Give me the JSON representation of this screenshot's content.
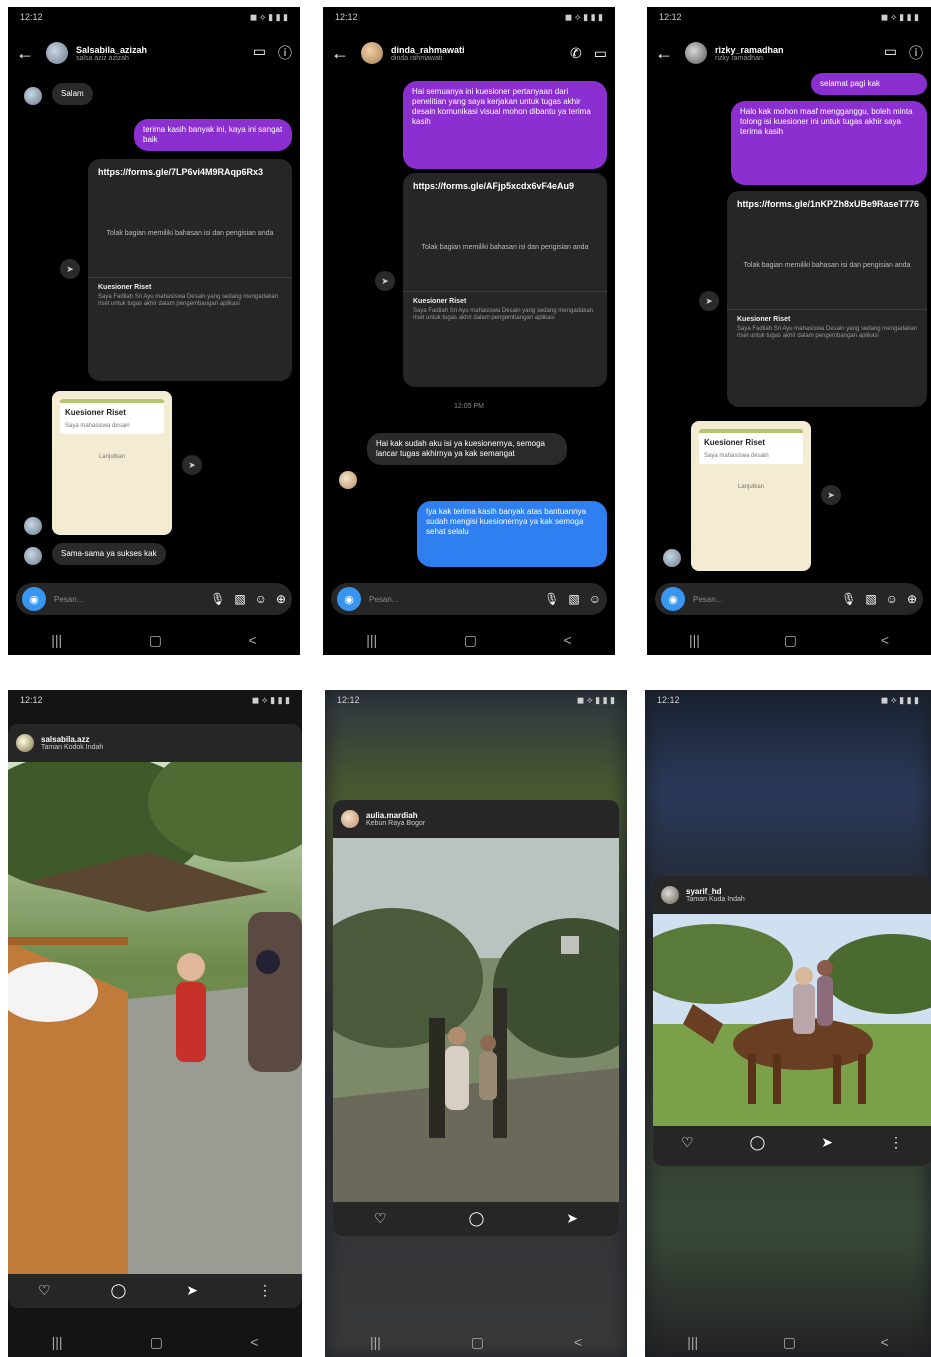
{
  "status": {
    "time": "12:12",
    "icons": "◉ ◈ ▣ ▤ ◦",
    "right": "◼ ⟡ ▮ ▮ ▮"
  },
  "nav": {
    "recent": "|||",
    "home": "▢",
    "back": "<"
  },
  "icons": {
    "back": "←",
    "video": "▭",
    "phone": "✆",
    "info": "ⓘ",
    "camera": "◉",
    "mic": "🎙",
    "gallery": "▧",
    "sticker": "☺",
    "plus": "⊕",
    "share": "➤",
    "heart": "♡",
    "comment": "◯",
    "send": "➤",
    "more": "⋮"
  },
  "composer": {
    "placeholder": "Pesan..."
  },
  "screens": [
    {
      "header": {
        "name": "Salsabila_azizah",
        "sub": "salsa aziz azizah"
      },
      "incoming_greeting": "Salam",
      "outgoing": "terima kasih banyak ini, kaya ini sangat baik",
      "link": {
        "url": "https://forms.gle/7LP6vi4M9RAqp6Rx3",
        "desc": "Tolak bagian memiliki bahasan isi dan pengisian anda",
        "title": "Kuesioner Riset",
        "body": "Saya Fadilah Sri Ayu mahasiswa Desain yang sedang mengadakan riset untuk tugas akhir dalam pengembangan aplikasi"
      },
      "form": {
        "title": "Kuesioner Riset",
        "line1": "Saya mahasiswa desain",
        "line2": "Lanjutkan"
      },
      "incoming_final": "Sama-sama ya sukses kak"
    },
    {
      "header": {
        "name": "dinda_rahmawati",
        "sub": "dinda rahmawati"
      },
      "outgoing": "Hai semuanya ini kuesioner pertanyaan dari penelitian yang saya kerjakan untuk tugas akhir desain komunikasi visual mohon dibantu ya terima kasih",
      "link": {
        "url": "https://forms.gle/AFjp5xcdx6vF4eAu9",
        "desc": "Tolak bagian memiliki bahasan isi dan pengisian anda",
        "title": "Kuesioner Riset",
        "body": "Saya Fadilah Sri Ayu mahasiswa Desain yang sedang mengadakan riset untuk tugas akhir dalam pengembangan aplikasi"
      },
      "time": "12:05 PM",
      "incoming": "Hai kak sudah aku isi ya kuesionernya, semoga lancar tugas akhirnya ya kak semangat",
      "blue": "Iya kak terima kasih banyak atas bantuannya sudah mengisi kuesionernya ya kak semoga sehat selalu"
    },
    {
      "header": {
        "name": "rizky_ramadhan",
        "sub": "rizky ramadhan"
      },
      "outgoing_short": "selamat pagi kak",
      "outgoing": "Halo kak mohon maaf mengganggu, boleh minta tolong isi kuesioner ini untuk tugas akhir saya terima kasih",
      "link": {
        "url": "https://forms.gle/1nKPZh8xUBe9RaseT776",
        "desc": "Tolak bagian memiliki bahasan isi dan pengisian anda",
        "title": "Kuesioner Riset",
        "body": "Saya Fadilah Sri Ayu mahasiswa Desain yang sedang mengadakan riset untuk tugas akhir dalam pengembangan aplikasi"
      },
      "form": {
        "title": "Kuesioner Riset",
        "line1": "Saya mahasiswa desain",
        "line2": "Lanjutkan"
      }
    }
  ],
  "feeds": [
    {
      "user": "salsabila.azz",
      "location": "Taman Kodok Indah"
    },
    {
      "user": "aulia.mardiah",
      "location": "Kebun Raya Bogor"
    },
    {
      "user": "syarif_hd",
      "location": "Taman Kuda Indah"
    }
  ]
}
